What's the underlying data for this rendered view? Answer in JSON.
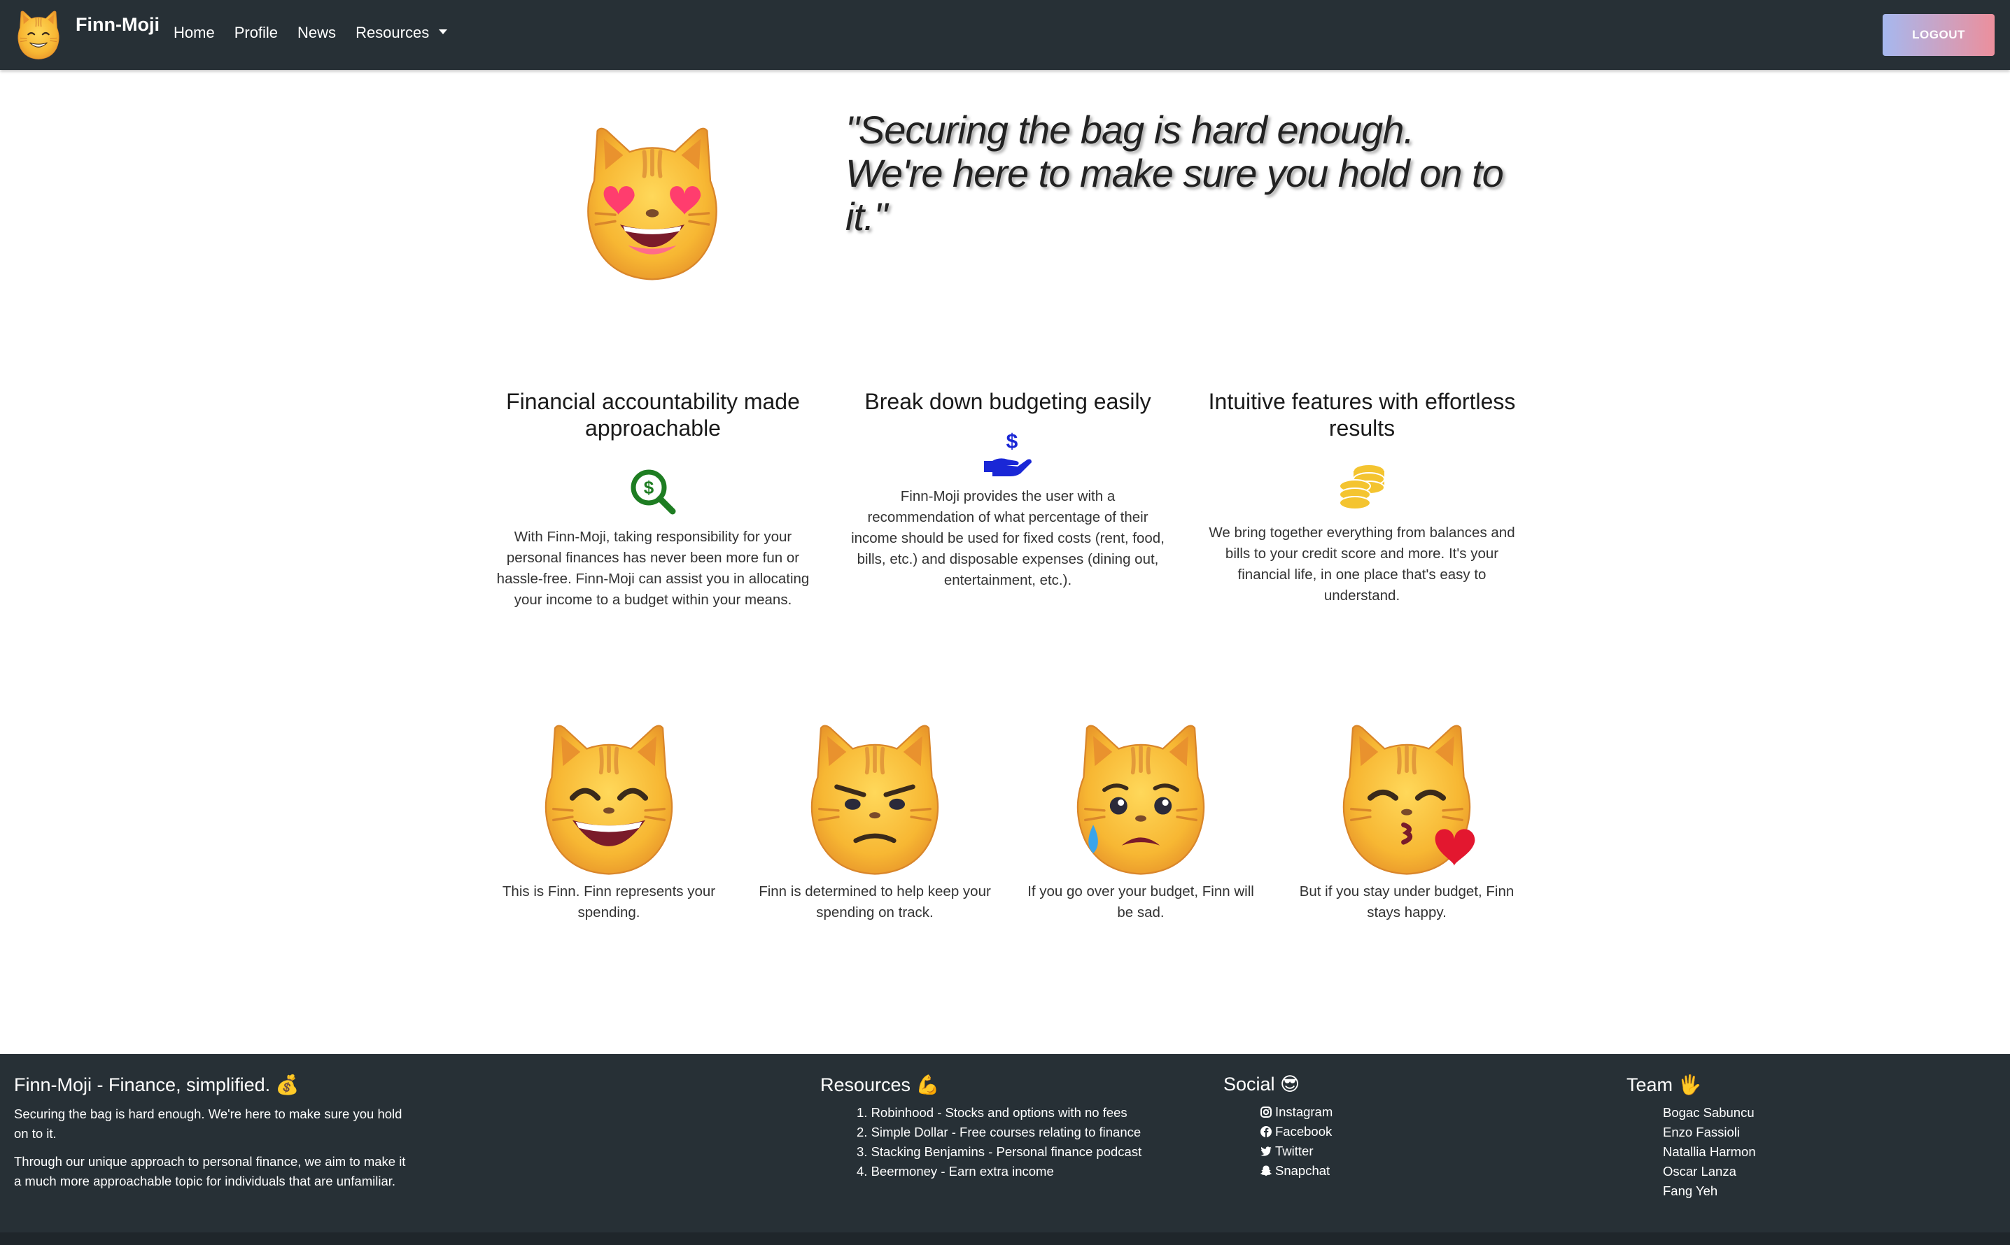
{
  "nav": {
    "brand": "Finn-Moji",
    "links": [
      "Home",
      "Profile",
      "News",
      "Resources"
    ],
    "logout": "LOGOUT"
  },
  "hero": {
    "quote": "\"Securing the bag is hard enough. We're here to make sure you hold on to it.\""
  },
  "features": [
    {
      "title": "Financial accountability made approachable",
      "icon": "search-dollar-icon",
      "text": "With Finn-Moji, taking responsibility for your personal finances has never been more fun or hassle-free. Finn-Moji can assist you in allocating your income to a budget within your means."
    },
    {
      "title": "Break down budgeting easily",
      "icon": "hand-holding-dollar-icon",
      "text": "Finn-Moji provides the user with a recommendation of what percentage of their income should be used for fixed costs (rent, food, bills, etc.) and disposable expenses (dining out, entertainment, etc.)."
    },
    {
      "title": "Intuitive features with effortless results",
      "icon": "coins-icon",
      "text": "We bring together everything from balances and bills to your credit score and more. It's your financial life, in one place that's easy to understand."
    }
  ],
  "cats": [
    {
      "icon": "grinning-cat-icon",
      "text": "This is Finn. Finn represents your spending."
    },
    {
      "icon": "determined-cat-icon",
      "text": "Finn is determined to help keep your spending on track."
    },
    {
      "icon": "sad-cat-icon",
      "text": "If you go over your budget, Finn will be sad."
    },
    {
      "icon": "kissing-cat-icon",
      "text": "But if you stay under budget, Finn stays happy."
    }
  ],
  "footer": {
    "about": {
      "title": "Finn-Moji - Finance, simplified. 💰",
      "p1": "Securing the bag is hard enough. We're here to make sure you hold on to it.",
      "p2": "Through our unique approach to personal finance, we aim to make it a much more approachable topic for individuals that are unfamiliar."
    },
    "resources": {
      "title": "Resources 💪",
      "items": [
        "1. Robinhood - Stocks and options with no fees",
        "2. Simple Dollar - Free courses relating to finance",
        "3. Stacking Benjamins - Personal finance podcast",
        "4. Beermoney - Earn extra income"
      ]
    },
    "social": {
      "title": "Social 😎",
      "items": [
        "Instagram",
        "Facebook",
        "Twitter",
        "Snapchat"
      ]
    },
    "team": {
      "title": "Team 🖐",
      "members": [
        "Bogac Sabuncu",
        "Enzo Fassioli",
        "Natallia Harmon",
        "Oscar Lanza",
        "Fang Yeh"
      ]
    }
  },
  "colors": {
    "navbar": "#273036",
    "logout_gradient_start": "#a6b8ef",
    "logout_gradient_end": "#ec8f9c",
    "icon_green": "#1e7d22",
    "icon_blue": "#1a27d6",
    "icon_gold": "#f4c430"
  }
}
